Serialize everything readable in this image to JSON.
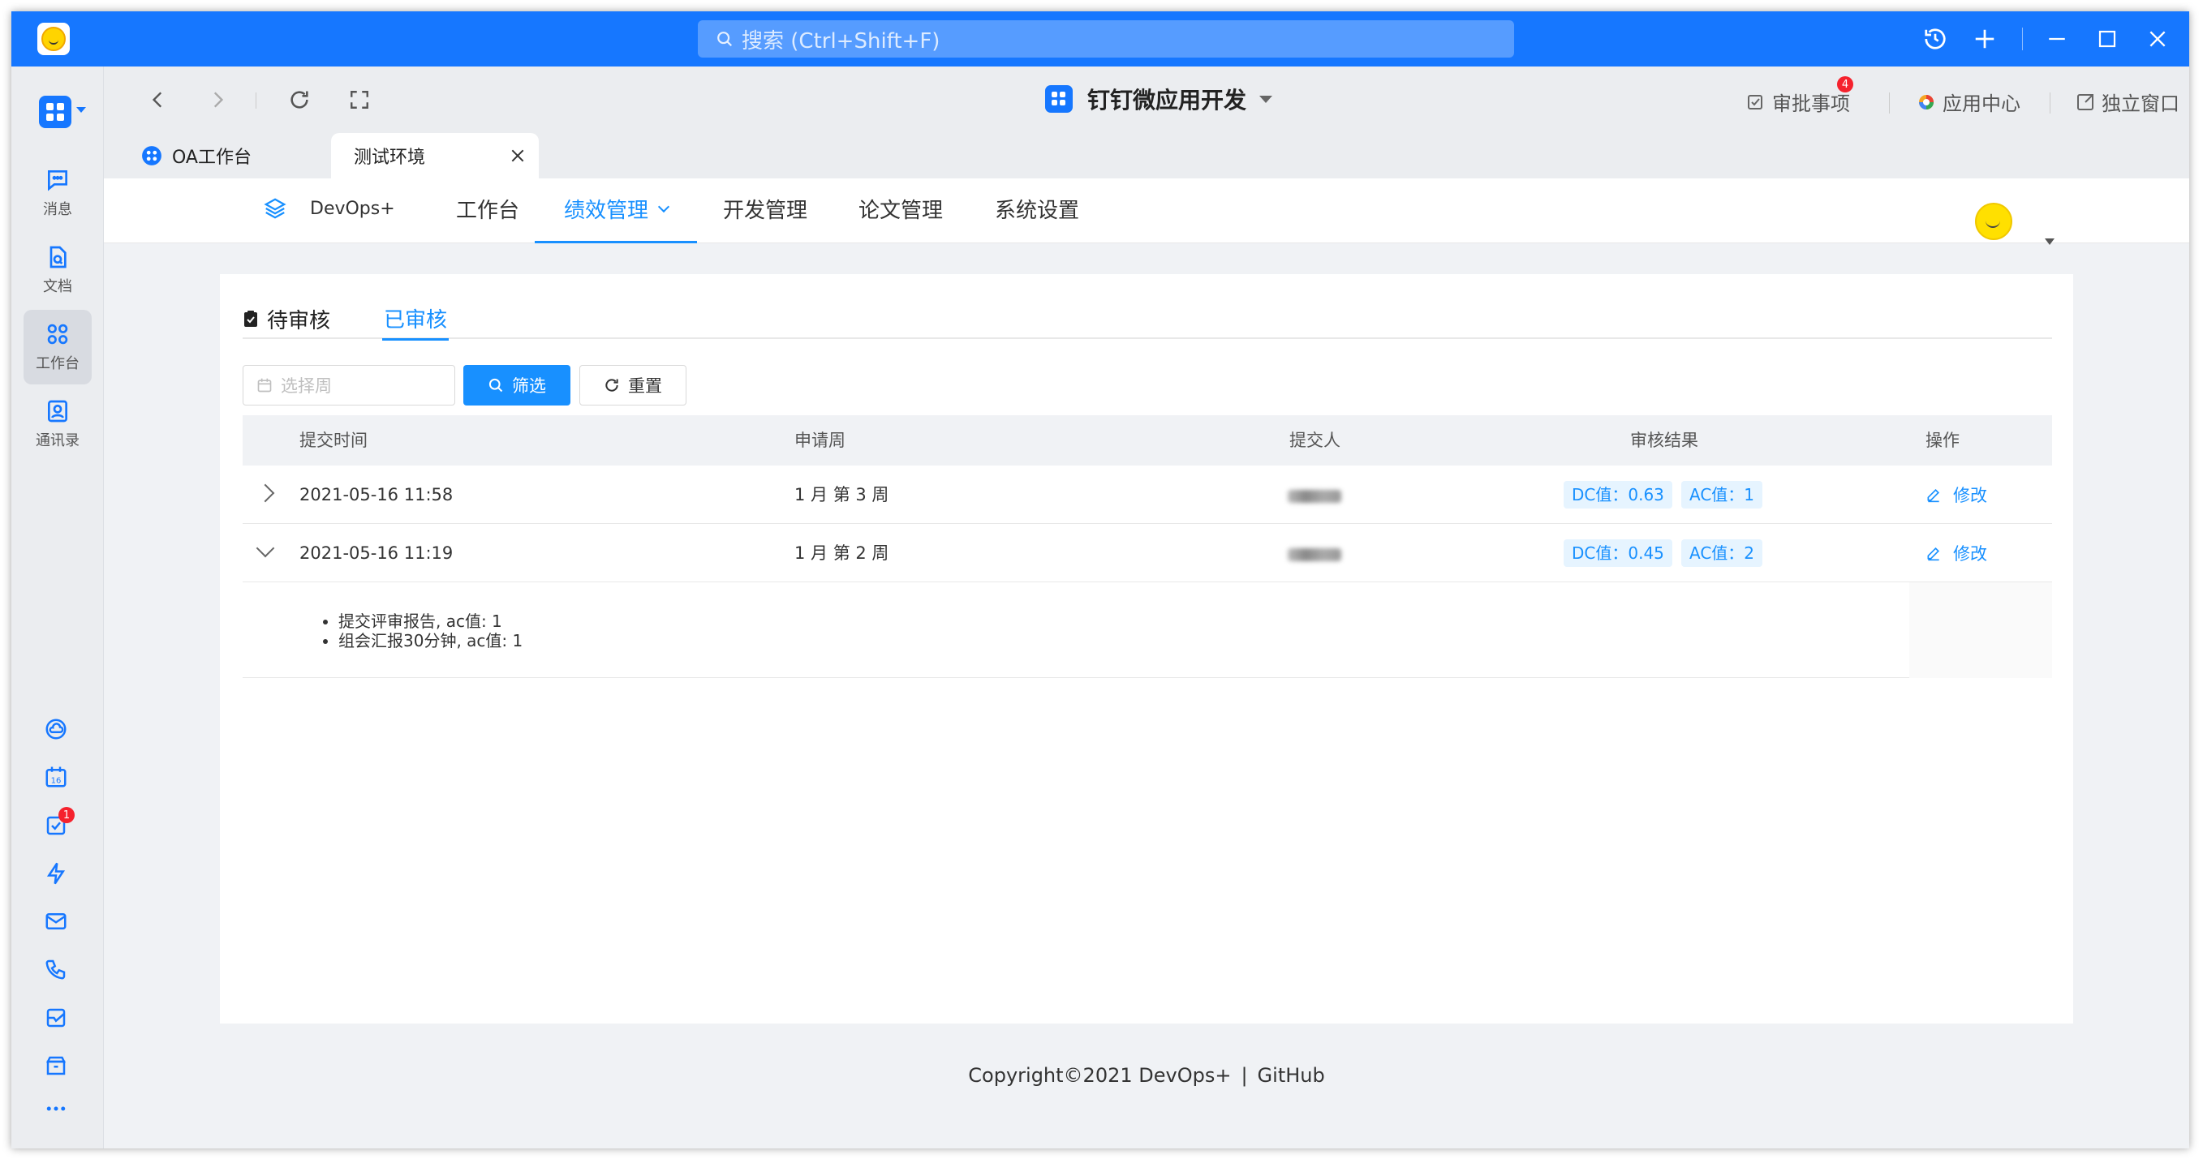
{
  "titlebar": {
    "search_placeholder": "搜索 (Ctrl+Shift+F)"
  },
  "sidebar": {
    "items": [
      {
        "label": "消息",
        "icon": "message-icon"
      },
      {
        "label": "文档",
        "icon": "document-icon"
      },
      {
        "label": "工作台",
        "icon": "workbench-icon"
      },
      {
        "label": "通讯录",
        "icon": "contacts-icon"
      }
    ],
    "bottom_icons": [
      "cloud-icon",
      "calendar-icon",
      "todo-icon",
      "lightning-icon",
      "mail-icon",
      "phone-icon",
      "notes-icon",
      "archive-icon",
      "more-icon"
    ],
    "calendar_day": "16",
    "todo_badge": "1"
  },
  "toolbar": {
    "app_title": "钉钉微应用开发",
    "approval_label": "审批事项",
    "approval_badge": "4",
    "app_center_label": "应用中心",
    "standalone_label": "独立窗口"
  },
  "tabs": [
    {
      "label": "OA工作台"
    },
    {
      "label": "测试环境"
    }
  ],
  "topnav": {
    "brand": "DevOps+",
    "items": [
      "工作台",
      "绩效管理",
      "开发管理",
      "论文管理",
      "系统设置"
    ],
    "active": "绩效管理"
  },
  "subtabs": {
    "pending": "待审核",
    "reviewed": "已审核"
  },
  "filter": {
    "week_placeholder": "选择周",
    "filter_label": "筛选",
    "reset_label": "重置"
  },
  "table": {
    "columns": [
      "提交时间",
      "申请周",
      "提交人",
      "审核结果",
      "操作"
    ],
    "rows": [
      {
        "submitted": "2021-05-16 11:58",
        "week": "1 月 第 3 周",
        "dc": "DC值：0.63",
        "ac": "AC值：1",
        "action": "修改",
        "expanded": false
      },
      {
        "submitted": "2021-05-16 11:19",
        "week": "1 月 第 2 周",
        "dc": "DC值：0.45",
        "ac": "AC值：2",
        "action": "修改",
        "expanded": true
      }
    ],
    "expanded_items": [
      "提交评审报告, ac值: 1",
      "组会汇报30分钟, ac值: 1"
    ]
  },
  "footer": {
    "copyright": "Copyright©2021 DevOps+",
    "separator": "|",
    "link": "GitHub"
  },
  "colors": {
    "titlebar": "#1677ff",
    "accent": "#1890ff",
    "tag_bg": "#e6f4ff",
    "badge": "#f5222d"
  }
}
